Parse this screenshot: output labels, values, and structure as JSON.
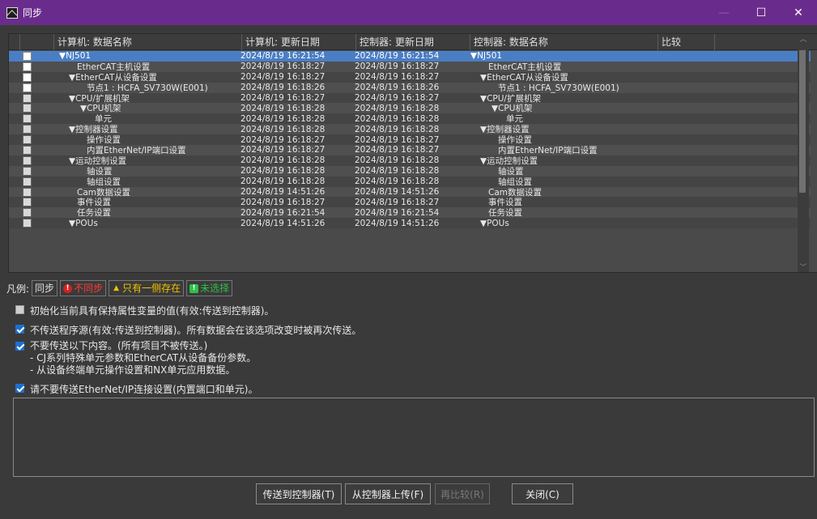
{
  "window": {
    "title": "同步",
    "min_label": "—",
    "max_label": "☐",
    "close_label": "✕"
  },
  "table": {
    "headers": [
      "",
      "计算机: 数据名称",
      "计算机: 更新日期",
      "控制器: 更新日期",
      "控制器: 数据名称",
      "比较",
      ""
    ],
    "rows": [
      {
        "name": "▼NJ501",
        "d1": "2024/8/19 16:21:54",
        "d2": "2024/8/19 16:21:54",
        "name2": "▼NJ501"
      },
      {
        "name": "EtherCAT主机设置",
        "d1": "2024/8/19 16:18:27",
        "d2": "2024/8/19 16:18:27",
        "name2": "EtherCAT主机设置"
      },
      {
        "name": "▼EtherCAT从设备设置",
        "d1": "2024/8/19 16:18:27",
        "d2": "2024/8/19 16:18:27",
        "name2": "▼EtherCAT从设备设置"
      },
      {
        "name": "节点1 : HCFA_SV730W(E001)",
        "d1": "2024/8/19 16:18:26",
        "d2": "2024/8/19 16:18:26",
        "name2": "节点1 : HCFA_SV730W(E001)"
      },
      {
        "name": "▼CPU/扩展机架",
        "d1": "2024/8/19 16:18:27",
        "d2": "2024/8/19 16:18:27",
        "name2": "▼CPU/扩展机架"
      },
      {
        "name": "▼CPU机架",
        "d1": "2024/8/19 16:18:28",
        "d2": "2024/8/19 16:18:28",
        "name2": "▼CPU机架"
      },
      {
        "name": "单元",
        "d1": "2024/8/19 16:18:28",
        "d2": "2024/8/19 16:18:28",
        "name2": "单元"
      },
      {
        "name": "▼控制器设置",
        "d1": "2024/8/19 16:18:28",
        "d2": "2024/8/19 16:18:28",
        "name2": "▼控制器设置"
      },
      {
        "name": "操作设置",
        "d1": "2024/8/19 16:18:27",
        "d2": "2024/8/19 16:18:27",
        "name2": "操作设置"
      },
      {
        "name": "内置EtherNet/IP端口设置",
        "d1": "2024/8/19 16:18:27",
        "d2": "2024/8/19 16:18:27",
        "name2": "内置EtherNet/IP端口设置"
      },
      {
        "name": "▼运动控制设置",
        "d1": "2024/8/19 16:18:28",
        "d2": "2024/8/19 16:18:28",
        "name2": "▼运动控制设置"
      },
      {
        "name": "轴设置",
        "d1": "2024/8/19 16:18:28",
        "d2": "2024/8/19 16:18:28",
        "name2": "轴设置"
      },
      {
        "name": "轴组设置",
        "d1": "2024/8/19 16:18:28",
        "d2": "2024/8/19 16:18:28",
        "name2": "轴组设置"
      },
      {
        "name": "Cam数据设置",
        "d1": "2024/8/19 14:51:26",
        "d2": "2024/8/19 14:51:26",
        "name2": "Cam数据设置"
      },
      {
        "name": "事件设置",
        "d1": "2024/8/19 16:18:27",
        "d2": "2024/8/19 16:18:27",
        "name2": "事件设置"
      },
      {
        "name": "任务设置",
        "d1": "2024/8/19 16:21:54",
        "d2": "2024/8/19 16:21:54",
        "name2": "任务设置"
      },
      {
        "name": "▼POUs",
        "d1": "2024/8/19 14:51:26",
        "d2": "2024/8/19 14:51:26",
        "name2": "▼POUs"
      }
    ]
  },
  "legend": {
    "prefix": "凡例:",
    "sync": "同步",
    "nosync": "不同步",
    "oneside": "只有一侧存在",
    "unselected": "未选择"
  },
  "options": {
    "opt1": "初始化当前具有保持属性变量的值(有效:传送到控制器)。",
    "opt2": "不传送程序源(有效:传送到控制器)。所有数据会在该选项改变时被再次传送。",
    "opt3_line1": "不要传送以下内容。(所有项目不被传送。)",
    "opt3_line2": "- CJ系列特殊单元参数和EtherCAT从设备备份参数。",
    "opt3_line3": "- 从设备终端单元操作设置和NX单元应用数据。",
    "opt4": "请不要传送EtherNet/IP连接设置(内置端口和单元)。"
  },
  "buttons": {
    "transfer_to": "传送到控制器(T)",
    "upload_from": "从控制器上传(F)",
    "recompare": "再比较(R)",
    "close": "关闭(C)"
  }
}
